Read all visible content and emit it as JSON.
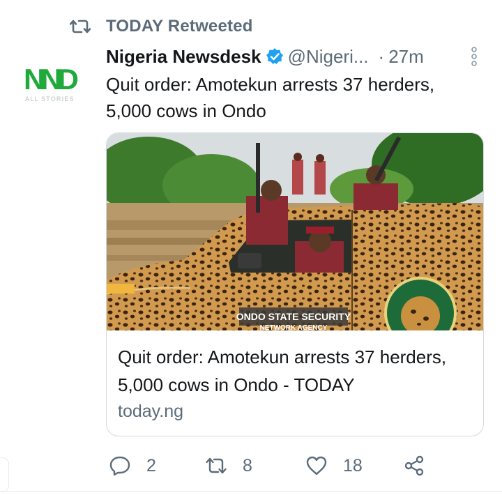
{
  "retweet": {
    "label": "TODAY Retweeted"
  },
  "avatar": {
    "logo_text": "NND",
    "logo_sub": "ALL STORIES"
  },
  "author": {
    "name": "Nigeria Newsdesk",
    "handle": "@Nigeri...",
    "separator": "·",
    "time": "27m"
  },
  "tweet": {
    "text": "Quit order: Amotekun arrests 37 herders, 5,000 cows in Ondo"
  },
  "card": {
    "title": "Quit order: Amotekun arrests 37 herders, 5,000 cows in Ondo - TODAY",
    "domain": "today.ng",
    "image_text": {
      "door_label": "ONDO STATE SECURITY",
      "door_label_2": "NETWORK AGENCY",
      "emblem": "ONDO STATE SECURITY NETWORK AGENCY"
    }
  },
  "actions": {
    "reply_count": "2",
    "retweet_count": "8",
    "like_count": "18"
  },
  "colors": {
    "secondary_text": "#5b6b79",
    "verified": "#1da1f2",
    "logo_green": "#1faa3b"
  }
}
